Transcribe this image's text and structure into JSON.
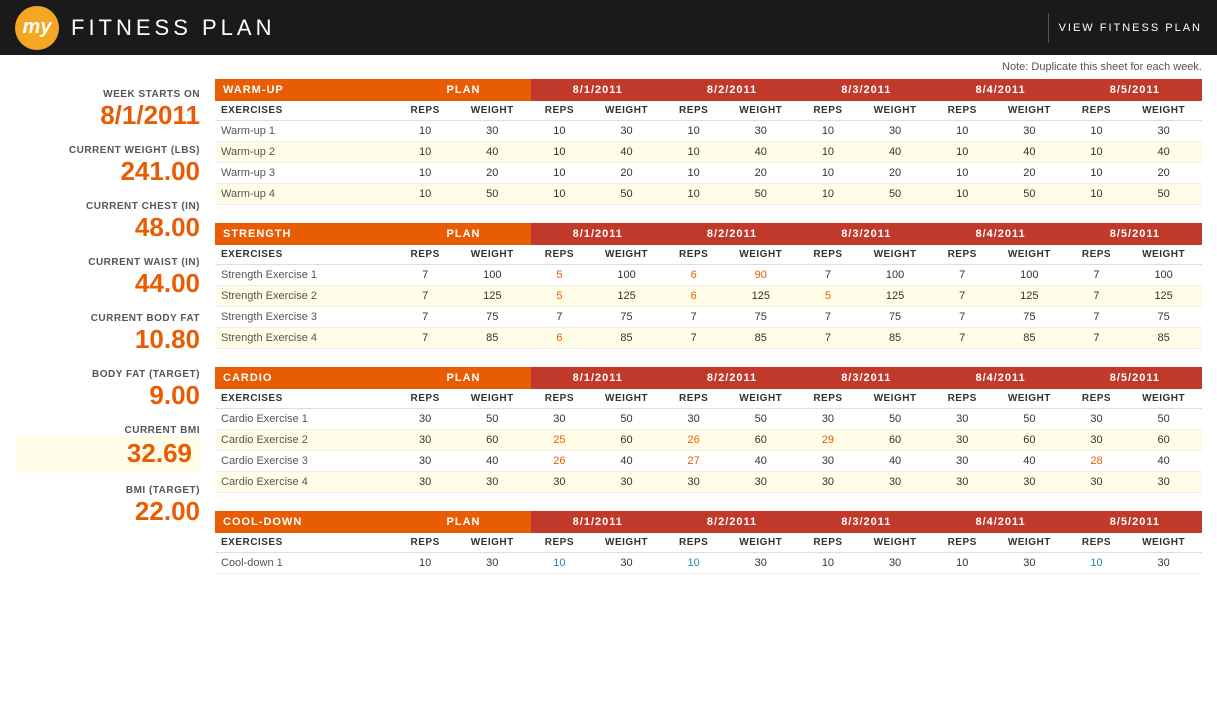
{
  "header": {
    "logo": "my",
    "title": "FITNESS PLAN",
    "view_plan": "VIEW  FITNESS  PLAN"
  },
  "note": "Note: Duplicate this sheet for each week.",
  "sidebar": {
    "week_starts_label": "WEEK STARTS ON",
    "week_starts_value": "8/1/2011",
    "weight_label": "CURRENT WEIGHT (LBS)",
    "weight_value": "241.00",
    "chest_label": "CURRENT CHEST (IN)",
    "chest_value": "48.00",
    "waist_label": "CURRENT WAIST (IN)",
    "waist_value": "44.00",
    "bodyfat_label": "CURRENT BODY FAT",
    "bodyfat_value": "10.80",
    "bodyfat_target_label": "BODY FAT (TARGET)",
    "bodyfat_target_value": "9.00",
    "bmi_label": "CURRENT BMI",
    "bmi_value": "32.69",
    "bmi_target_label": "BMI (TARGET)",
    "bmi_target_value": "22.00"
  },
  "dates": [
    "8/1/2011",
    "8/2/2011",
    "8/3/2011",
    "8/4/2011",
    "8/5/2011"
  ],
  "sections": [
    {
      "name": "WARM-UP",
      "exercises": [
        {
          "name": "Warm-up 1",
          "plan_reps": 10,
          "plan_weight": 30,
          "days": [
            {
              "reps": 10,
              "weight": 30,
              "reps_h": "",
              "weight_h": ""
            },
            {
              "reps": 10,
              "weight": 30,
              "reps_h": "",
              "weight_h": ""
            },
            {
              "reps": 10,
              "weight": 30,
              "reps_h": "",
              "weight_h": ""
            },
            {
              "reps": 10,
              "weight": 30,
              "reps_h": "",
              "weight_h": ""
            },
            {
              "reps": 10,
              "weight": 30,
              "reps_h": "",
              "weight_h": ""
            }
          ]
        },
        {
          "name": "Warm-up 2",
          "plan_reps": 10,
          "plan_weight": 40,
          "days": [
            {
              "reps": 10,
              "weight": 40,
              "reps_h": "",
              "weight_h": ""
            },
            {
              "reps": 10,
              "weight": 40,
              "reps_h": "",
              "weight_h": ""
            },
            {
              "reps": 10,
              "weight": 40,
              "reps_h": "",
              "weight_h": ""
            },
            {
              "reps": 10,
              "weight": 40,
              "reps_h": "",
              "weight_h": ""
            },
            {
              "reps": 10,
              "weight": 40,
              "reps_h": "",
              "weight_h": ""
            }
          ]
        },
        {
          "name": "Warm-up 3",
          "plan_reps": 10,
          "plan_weight": 20,
          "days": [
            {
              "reps": 10,
              "weight": 20,
              "reps_h": "",
              "weight_h": ""
            },
            {
              "reps": 10,
              "weight": 20,
              "reps_h": "",
              "weight_h": ""
            },
            {
              "reps": 10,
              "weight": 20,
              "reps_h": "",
              "weight_h": ""
            },
            {
              "reps": 10,
              "weight": 20,
              "reps_h": "",
              "weight_h": ""
            },
            {
              "reps": 10,
              "weight": 20,
              "reps_h": "",
              "weight_h": ""
            }
          ]
        },
        {
          "name": "Warm-up 4",
          "plan_reps": 10,
          "plan_weight": 50,
          "days": [
            {
              "reps": 10,
              "weight": 50,
              "reps_h": "",
              "weight_h": ""
            },
            {
              "reps": 10,
              "weight": 50,
              "reps_h": "",
              "weight_h": ""
            },
            {
              "reps": 10,
              "weight": 50,
              "reps_h": "",
              "weight_h": ""
            },
            {
              "reps": 10,
              "weight": 50,
              "reps_h": "",
              "weight_h": ""
            },
            {
              "reps": 10,
              "weight": 50,
              "reps_h": "",
              "weight_h": ""
            }
          ]
        }
      ]
    },
    {
      "name": "STRENGTH",
      "exercises": [
        {
          "name": "Strength Exercise 1",
          "plan_reps": 7,
          "plan_weight": 100,
          "days": [
            {
              "reps": 5,
              "weight": 100,
              "reps_h": "orange",
              "weight_h": ""
            },
            {
              "reps": 6,
              "weight": 90,
              "reps_h": "orange",
              "weight_h": "orange"
            },
            {
              "reps": 7,
              "weight": 100,
              "reps_h": "",
              "weight_h": ""
            },
            {
              "reps": 7,
              "weight": 100,
              "reps_h": "",
              "weight_h": ""
            },
            {
              "reps": 7,
              "weight": 100,
              "reps_h": "",
              "weight_h": ""
            }
          ]
        },
        {
          "name": "Strength Exercise 2",
          "plan_reps": 7,
          "plan_weight": 125,
          "days": [
            {
              "reps": 5,
              "weight": 125,
              "reps_h": "orange",
              "weight_h": ""
            },
            {
              "reps": 6,
              "weight": 125,
              "reps_h": "orange",
              "weight_h": ""
            },
            {
              "reps": 5,
              "weight": 125,
              "reps_h": "orange",
              "weight_h": ""
            },
            {
              "reps": 7,
              "weight": 125,
              "reps_h": "",
              "weight_h": ""
            },
            {
              "reps": 7,
              "weight": 125,
              "reps_h": "",
              "weight_h": ""
            }
          ]
        },
        {
          "name": "Strength Exercise 3",
          "plan_reps": 7,
          "plan_weight": 75,
          "days": [
            {
              "reps": 7,
              "weight": 75,
              "reps_h": "",
              "weight_h": ""
            },
            {
              "reps": 7,
              "weight": 75,
              "reps_h": "",
              "weight_h": ""
            },
            {
              "reps": 7,
              "weight": 75,
              "reps_h": "",
              "weight_h": ""
            },
            {
              "reps": 7,
              "weight": 75,
              "reps_h": "",
              "weight_h": ""
            },
            {
              "reps": 7,
              "weight": 75,
              "reps_h": "",
              "weight_h": ""
            }
          ]
        },
        {
          "name": "Strength Exercise 4",
          "plan_reps": 7,
          "plan_weight": 85,
          "days": [
            {
              "reps": 6,
              "weight": 85,
              "reps_h": "orange",
              "weight_h": ""
            },
            {
              "reps": 7,
              "weight": 85,
              "reps_h": "",
              "weight_h": ""
            },
            {
              "reps": 7,
              "weight": 85,
              "reps_h": "",
              "weight_h": ""
            },
            {
              "reps": 7,
              "weight": 85,
              "reps_h": "",
              "weight_h": ""
            },
            {
              "reps": 7,
              "weight": 85,
              "reps_h": "",
              "weight_h": ""
            }
          ]
        }
      ]
    },
    {
      "name": "CARDIO",
      "exercises": [
        {
          "name": "Cardio Exercise 1",
          "plan_reps": 30,
          "plan_weight": 50,
          "days": [
            {
              "reps": 30,
              "weight": 50,
              "reps_h": "",
              "weight_h": ""
            },
            {
              "reps": 30,
              "weight": 50,
              "reps_h": "",
              "weight_h": ""
            },
            {
              "reps": 30,
              "weight": 50,
              "reps_h": "",
              "weight_h": ""
            },
            {
              "reps": 30,
              "weight": 50,
              "reps_h": "",
              "weight_h": ""
            },
            {
              "reps": 30,
              "weight": 50,
              "reps_h": "",
              "weight_h": ""
            }
          ]
        },
        {
          "name": "Cardio Exercise 2",
          "plan_reps": 30,
          "plan_weight": 60,
          "days": [
            {
              "reps": 25,
              "weight": 60,
              "reps_h": "orange",
              "weight_h": ""
            },
            {
              "reps": 26,
              "weight": 60,
              "reps_h": "orange",
              "weight_h": ""
            },
            {
              "reps": 29,
              "weight": 60,
              "reps_h": "orange",
              "weight_h": ""
            },
            {
              "reps": 30,
              "weight": 60,
              "reps_h": "",
              "weight_h": ""
            },
            {
              "reps": 30,
              "weight": 60,
              "reps_h": "",
              "weight_h": ""
            }
          ]
        },
        {
          "name": "Cardio Exercise 3",
          "plan_reps": 30,
          "plan_weight": 40,
          "days": [
            {
              "reps": 26,
              "weight": 40,
              "reps_h": "orange",
              "weight_h": ""
            },
            {
              "reps": 27,
              "weight": 40,
              "reps_h": "orange",
              "weight_h": ""
            },
            {
              "reps": 30,
              "weight": 40,
              "reps_h": "",
              "weight_h": ""
            },
            {
              "reps": 30,
              "weight": 40,
              "reps_h": "",
              "weight_h": ""
            },
            {
              "reps": 28,
              "weight": 40,
              "reps_h": "orange",
              "weight_h": ""
            }
          ]
        },
        {
          "name": "Cardio Exercise 4",
          "plan_reps": 30,
          "plan_weight": 30,
          "days": [
            {
              "reps": 30,
              "weight": 30,
              "reps_h": "",
              "weight_h": ""
            },
            {
              "reps": 30,
              "weight": 30,
              "reps_h": "",
              "weight_h": ""
            },
            {
              "reps": 30,
              "weight": 30,
              "reps_h": "",
              "weight_h": ""
            },
            {
              "reps": 30,
              "weight": 30,
              "reps_h": "",
              "weight_h": ""
            },
            {
              "reps": 30,
              "weight": 30,
              "reps_h": "",
              "weight_h": ""
            }
          ]
        }
      ]
    },
    {
      "name": "COOL-DOWN",
      "exercises": [
        {
          "name": "Cool-down 1",
          "plan_reps": 10,
          "plan_weight": 30,
          "days": [
            {
              "reps": 10,
              "weight": 30,
              "reps_h": "blue",
              "weight_h": ""
            },
            {
              "reps": 10,
              "weight": 30,
              "reps_h": "blue",
              "weight_h": ""
            },
            {
              "reps": 10,
              "weight": 30,
              "reps_h": "",
              "weight_h": ""
            },
            {
              "reps": 10,
              "weight": 30,
              "reps_h": "",
              "weight_h": ""
            },
            {
              "reps": 10,
              "weight": 30,
              "reps_h": "blue",
              "weight_h": ""
            }
          ]
        }
      ]
    }
  ],
  "col_labels": {
    "exercises": "EXERCISES",
    "reps": "REPS",
    "weight": "WEIGHT",
    "plan": "PLAN"
  }
}
